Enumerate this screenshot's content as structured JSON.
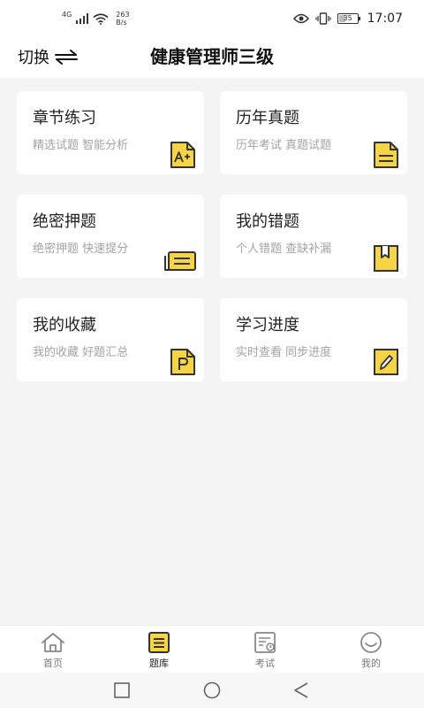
{
  "status_bar": {
    "network": "4G",
    "speed_value": "263",
    "speed_unit": "B/s",
    "battery": "35",
    "battery_level_percent": 35,
    "time": "17:07"
  },
  "header": {
    "switch_label": "切换",
    "title": "健康管理师三级"
  },
  "cards": [
    {
      "title": "章节练习",
      "subtitle": "精选试题 智能分析",
      "icon": "a-plus-doc-icon"
    },
    {
      "title": "历年真题",
      "subtitle": "历年考试 真题试题",
      "icon": "document-icon"
    },
    {
      "title": "绝密押题",
      "subtitle": "绝密押题 快速提分",
      "icon": "ticket-icon"
    },
    {
      "title": "我的错题",
      "subtitle": "个人错题 查缺补漏",
      "icon": "bookmark-book-icon"
    },
    {
      "title": "我的收藏",
      "subtitle": "我的收藏 好题汇总",
      "icon": "p-doc-icon"
    },
    {
      "title": "学习进度",
      "subtitle": "实时查看 同步进度",
      "icon": "pencil-doc-icon"
    }
  ],
  "tabs": [
    {
      "label": "首页",
      "icon": "home-icon",
      "active": false
    },
    {
      "label": "题库",
      "icon": "question-bank-icon",
      "active": true
    },
    {
      "label": "考试",
      "icon": "exam-icon",
      "active": false
    },
    {
      "label": "我的",
      "icon": "profile-icon",
      "active": false
    }
  ],
  "colors": {
    "accent": "#f5d547",
    "icon_stroke": "#333333",
    "background": "#f4f4f4",
    "card": "#ffffff",
    "subtitle": "#a3a3a3"
  }
}
